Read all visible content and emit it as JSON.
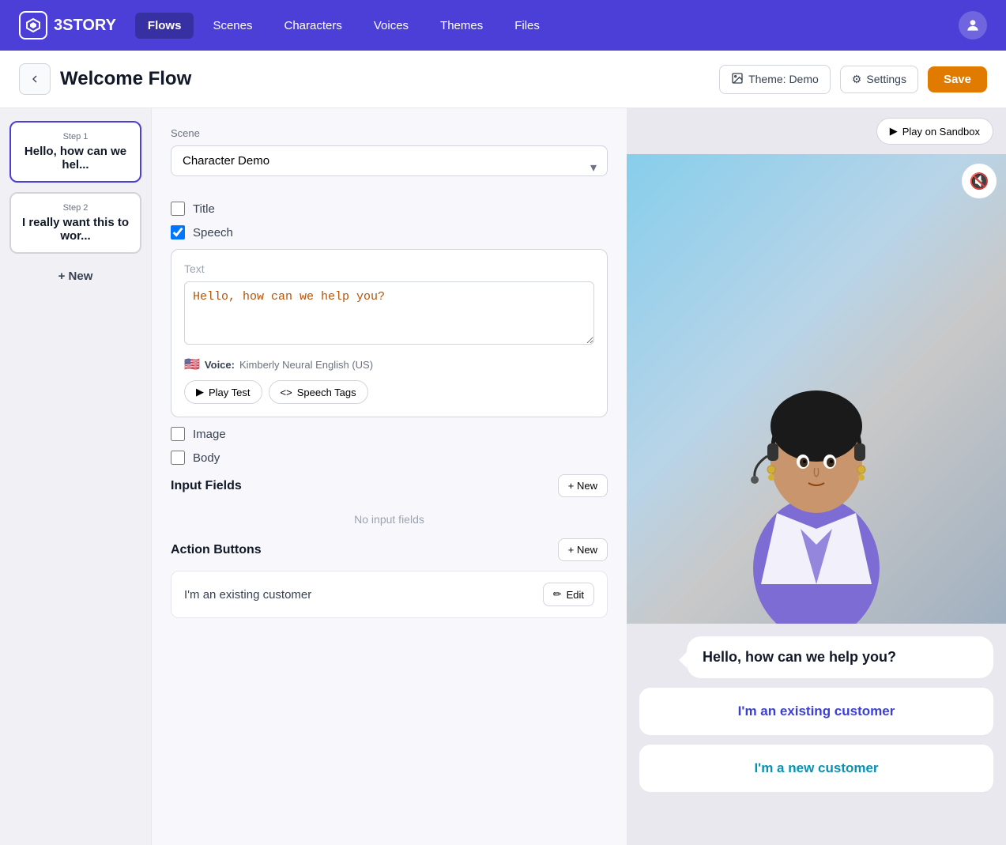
{
  "app": {
    "name": "3STORY",
    "logo_symbol": "⬡"
  },
  "nav": {
    "items": [
      {
        "id": "flows",
        "label": "Flows",
        "active": true
      },
      {
        "id": "scenes",
        "label": "Scenes",
        "active": false
      },
      {
        "id": "characters",
        "label": "Characters",
        "active": false
      },
      {
        "id": "voices",
        "label": "Voices",
        "active": false
      },
      {
        "id": "themes",
        "label": "Themes",
        "active": false
      },
      {
        "id": "files",
        "label": "Files",
        "active": false
      }
    ]
  },
  "header": {
    "back_label": "←",
    "page_title": "Welcome Flow",
    "theme_label": "Theme: Demo",
    "settings_label": "Settings",
    "save_label": "Save"
  },
  "sidebar": {
    "steps": [
      {
        "id": "step1",
        "label": "Step 1",
        "text": "Hello, how can we hel...",
        "active": true
      },
      {
        "id": "step2",
        "label": "Step 2",
        "text": "I really want this to wor...",
        "active": false
      }
    ],
    "new_label": "+ New"
  },
  "editor": {
    "scene_label": "Scene",
    "scene_value": "Character Demo",
    "title_label": "Title",
    "title_checked": false,
    "speech_label": "Speech",
    "speech_checked": true,
    "text_section_label": "Text",
    "speech_text": "Hello, how can we help you?",
    "voice_flag": "🇺🇸",
    "voice_label": "Voice:",
    "voice_name": "Kimberly Neural English (US)",
    "play_test_label": "Play Test",
    "speech_tags_label": "Speech Tags",
    "image_label": "Image",
    "image_checked": false,
    "body_label": "Body",
    "body_checked": false,
    "input_fields_label": "Input Fields",
    "input_fields_add": "+ New",
    "no_input_fields_text": "No input fields",
    "action_buttons_label": "Action Buttons",
    "action_buttons_add": "+ New",
    "action_button_text": "I'm an existing customer",
    "edit_label": "Edit"
  },
  "preview": {
    "play_sandbox_label": "Play on Sandbox",
    "mute_icon": "🔇",
    "speech_bubble_text": "Hello, how can we help you?",
    "option1_text": "I'm an existing customer",
    "option2_text": "I'm a new customer"
  },
  "bottom_edit": {
    "text": "I'm an existing customer",
    "edit_label": "Edit"
  },
  "icons": {
    "play": "▶",
    "code": "<>",
    "pencil": "✏",
    "gear": "⚙",
    "image": "🖼",
    "arrow_left": "←",
    "chevron_down": "▾"
  }
}
